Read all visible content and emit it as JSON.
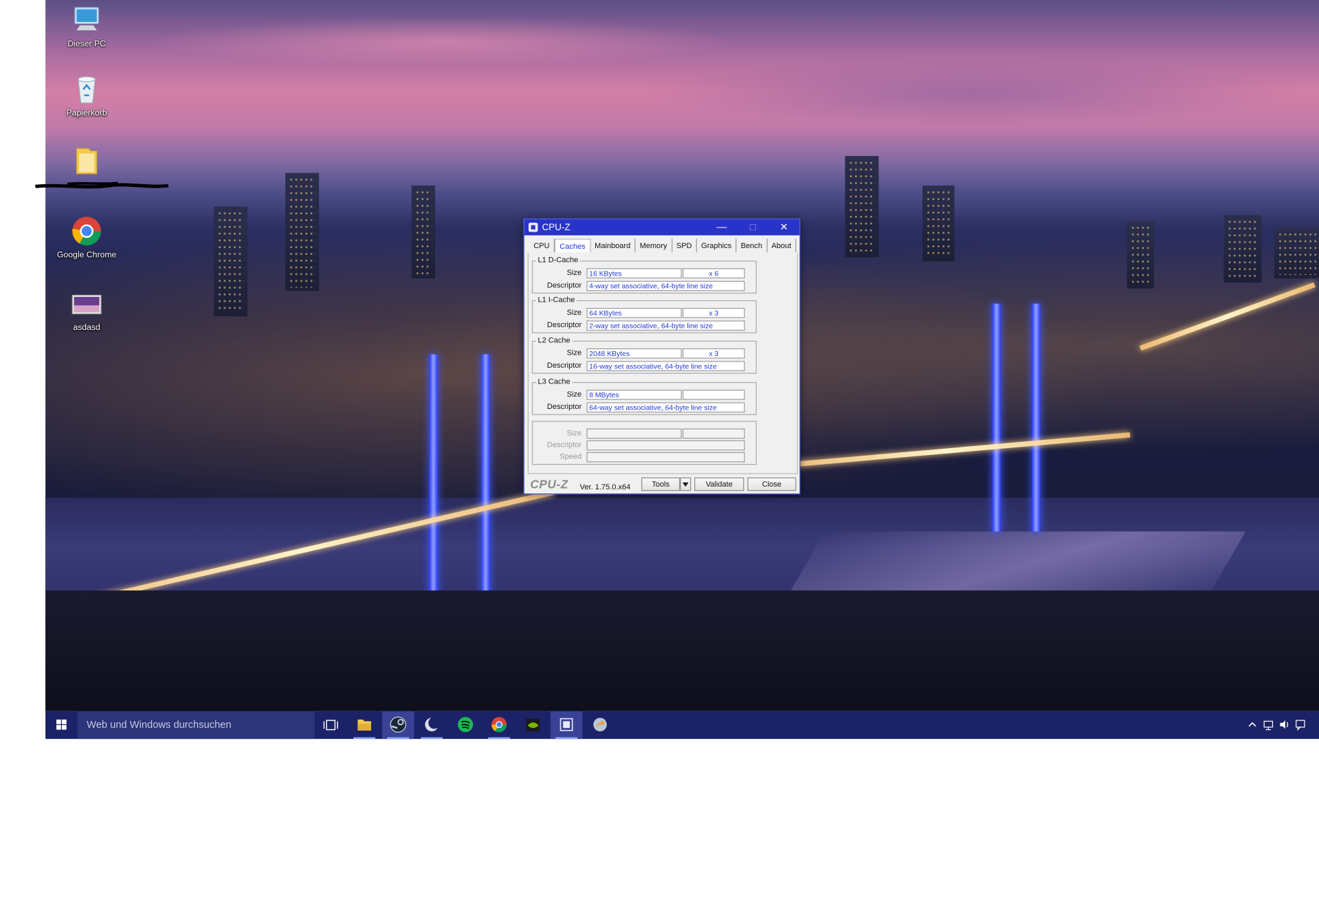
{
  "desktop": {
    "icons": [
      {
        "label": "Dieser PC",
        "icon": "this-pc-icon"
      },
      {
        "label": "Papierkorb",
        "icon": "recycle-bin-icon"
      },
      {
        "label": "",
        "icon": "folder-icon"
      },
      {
        "label": "Google Chrome",
        "icon": "chrome-icon"
      },
      {
        "label": "asdasd",
        "icon": "shortcut-image-icon"
      }
    ]
  },
  "window": {
    "title": "CPU-Z",
    "controls": {
      "minimize": "—",
      "maximize": "□",
      "close": "✕"
    },
    "tabs": [
      "CPU",
      "Caches",
      "Mainboard",
      "Memory",
      "SPD",
      "Graphics",
      "Bench",
      "About"
    ],
    "active_tab": "Caches",
    "groups": {
      "l1d": {
        "title": "L1 D-Cache",
        "size_label": "Size",
        "size": "16 KBytes",
        "count": "x 6",
        "desc_label": "Descriptor",
        "descriptor": "4-way set associative, 64-byte line size"
      },
      "l1i": {
        "title": "L1 I-Cache",
        "size_label": "Size",
        "size": "64 KBytes",
        "count": "x 3",
        "desc_label": "Descriptor",
        "descriptor": "2-way set associative, 64-byte line size"
      },
      "l2": {
        "title": "L2 Cache",
        "size_label": "Size",
        "size": "2048 KBytes",
        "count": "x 3",
        "desc_label": "Descriptor",
        "descriptor": "16-way set associative, 64-byte line size"
      },
      "l3": {
        "title": "L3 Cache",
        "size_label": "Size",
        "size": "8 MBytes",
        "count": "",
        "desc_label": "Descriptor",
        "descriptor": "64-way set associative, 64-byte line size"
      },
      "extra": {
        "size_label": "Size",
        "desc_label": "Descriptor",
        "speed_label": "Speed"
      }
    },
    "footer": {
      "brand": "CPU-Z",
      "version": "Ver. 1.75.0.x64",
      "tools": "Tools",
      "validate": "Validate",
      "close": "Close"
    }
  },
  "taskbar": {
    "search_placeholder": "Web und Windows durchsuchen",
    "apps": [
      "task-view-icon",
      "file-explorer-icon",
      "steam-icon",
      "app-moon-icon",
      "spotify-icon",
      "chrome-icon",
      "nvidia-icon",
      "cpuz-taskbar-icon",
      "app-bird-icon"
    ],
    "tray": [
      "chevron-up-icon",
      "network-icon",
      "volume-icon",
      "notification-icon"
    ]
  },
  "colors": {
    "accent": "#2a33c9",
    "value_text": "#1f38d6",
    "taskbar": "#1b2268"
  }
}
